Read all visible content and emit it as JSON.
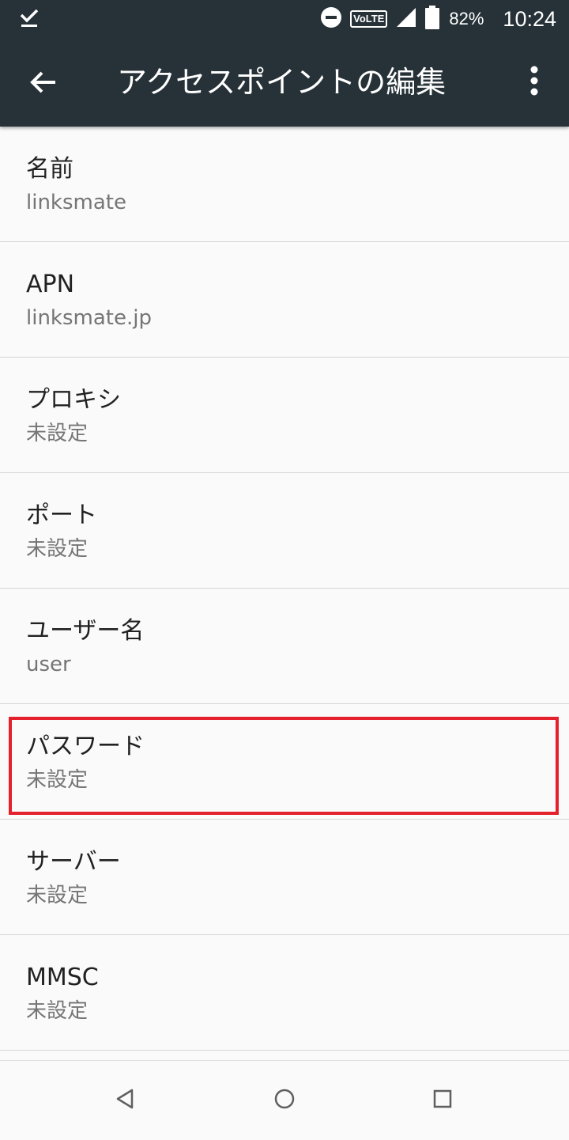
{
  "status_bar": {
    "left_icon": "check-icon",
    "dnd_icon": "do-not-disturb-icon",
    "volte_label": "VoLTE",
    "signal_icon": "signal-icon",
    "battery_icon": "battery-icon",
    "battery_percent": "82%",
    "time": "10:24"
  },
  "toolbar": {
    "back_icon": "arrow-back-icon",
    "title": "アクセスポイントの編集",
    "overflow_icon": "more-vert-icon"
  },
  "settings": {
    "items": [
      {
        "label": "名前",
        "value": "linksmate"
      },
      {
        "label": "APN",
        "value": "linksmate.jp"
      },
      {
        "label": "プロキシ",
        "value": "未設定"
      },
      {
        "label": "ポート",
        "value": "未設定"
      },
      {
        "label": "ユーザー名",
        "value": "user"
      },
      {
        "label": "パスワード",
        "value": "未設定"
      },
      {
        "label": "サーバー",
        "value": "未設定"
      },
      {
        "label": "MMSC",
        "value": "未設定"
      }
    ],
    "highlighted_item": "パスワード"
  },
  "navigation_bar": {
    "back_icon": "triangle-back-icon",
    "home_icon": "circle-home-icon",
    "recents_icon": "square-recents-icon"
  },
  "colors": {
    "toolbar_background": "#263238",
    "list_background": "#fafafa",
    "highlight_border": "#e3202b",
    "primary_text": "#212121",
    "secondary_text": "#757575"
  }
}
